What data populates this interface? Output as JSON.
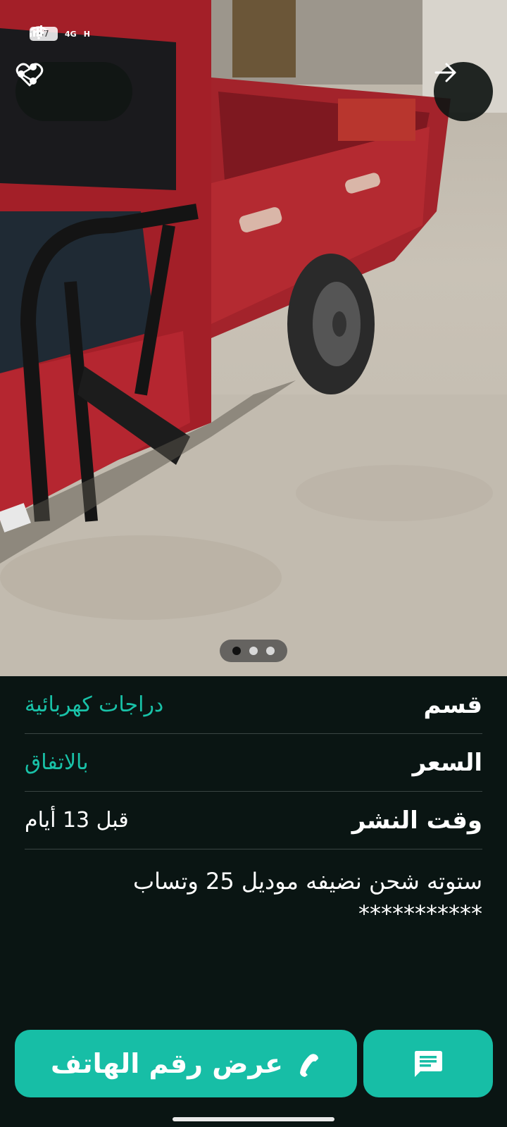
{
  "status_bar": {
    "battery": "47",
    "network": "4G",
    "signal_label": "H"
  },
  "photo": {
    "pager_total": 3,
    "pager_active": 0
  },
  "actions": {
    "share_icon": "share-icon",
    "favorite_icon": "heart-icon",
    "next_icon": "arrow-right-icon"
  },
  "details": {
    "category_label": "قسم",
    "category_value": "دراجات كهربائية",
    "price_label": "السعر",
    "price_value": "بالاتفاق",
    "posted_label": "وقت النشر",
    "posted_value": "قبل 13 أيام",
    "description_line1": "ستوته شحن نضيفه موديل 25 وتساب",
    "description_line2": "***********"
  },
  "bottom": {
    "call_label": "عرض رقم الهاتف",
    "call_icon": "phone-icon",
    "chat_icon": "chat-icon"
  },
  "colors": {
    "accent": "#17bea6",
    "background": "#0a1513",
    "divider": "#3a4543"
  }
}
